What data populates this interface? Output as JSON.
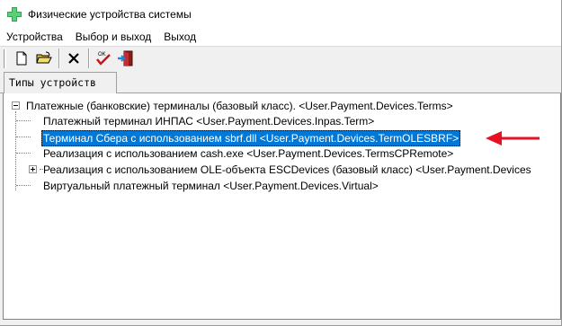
{
  "window": {
    "title": "Физические устройства системы",
    "title_icon": "green-plus-icon"
  },
  "menu": {
    "items": [
      "Устройства",
      "Выбор и выход",
      "Выход"
    ]
  },
  "toolbar": {
    "buttons": [
      "new-document-icon",
      "open-folder-icon",
      "delete-x-icon",
      "ok-check-icon",
      "exit-door-icon"
    ]
  },
  "tabs": {
    "active_label": "Типы устройств"
  },
  "tree": {
    "root": "Платежные (банковские) терминалы (базовый класс). <User.Payment.Devices.Terms>",
    "children": [
      "Платежный терминал ИНПАС <User.Payment.Devices.Inpas.Term>",
      "Терминал Сбера с использованием sbrf.dll  <User.Payment.Devices.TermOLESBRF>",
      "Реализация с использованием cash.exe <User.Payment.Devices.TermsCPRemote>",
      "Реализация с использованием OLE-объекта ESCDevices (базовый класс)  <User.Payment.Devices",
      "Виртуальный платежный терминал <User.Payment.Devices.Virtual>"
    ],
    "selected_index": 1,
    "expandable_index": 3
  },
  "colors": {
    "selection": "#0078d7",
    "annotation_arrow": "#e81123"
  }
}
